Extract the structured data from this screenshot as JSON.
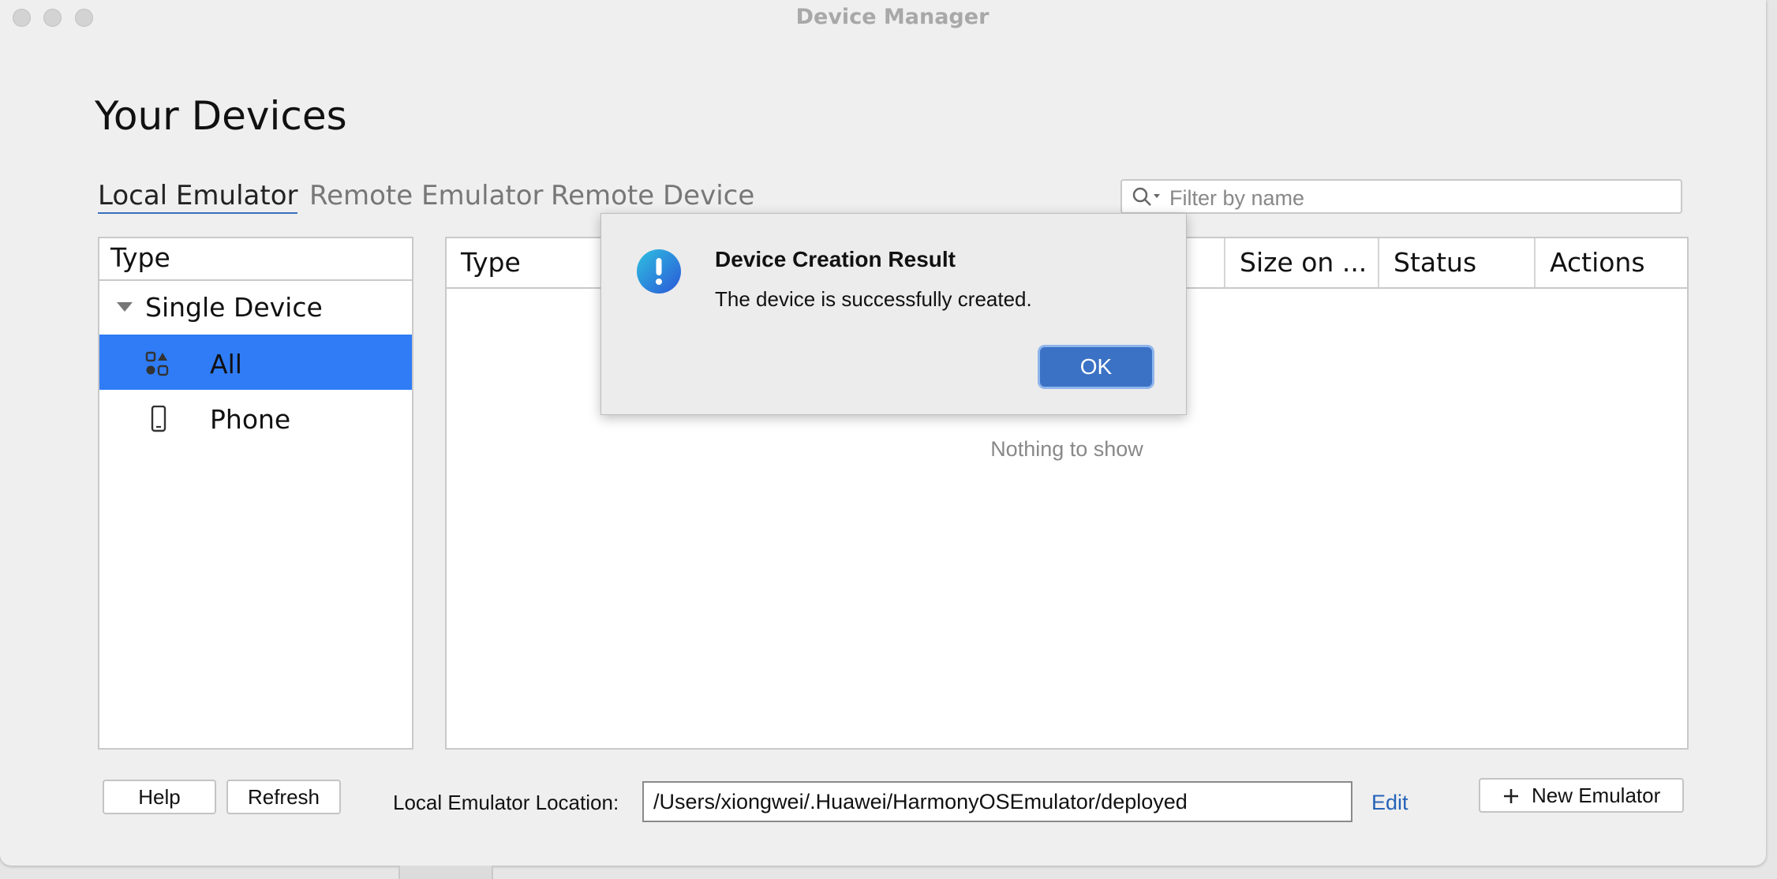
{
  "window": {
    "title": "Device Manager"
  },
  "page": {
    "title": "Your Devices"
  },
  "tabs": [
    {
      "label": "Local Emulator",
      "active": true
    },
    {
      "label": "Remote Emulator",
      "active": false
    },
    {
      "label": "Remote Device",
      "active": false
    }
  ],
  "search": {
    "placeholder": "Filter by name",
    "value": "",
    "icon": "search-filter-icon"
  },
  "left_panel": {
    "header": "Type",
    "group": "Single Device",
    "items": [
      {
        "label": "All",
        "icon": "grid-shapes-icon",
        "selected": true
      },
      {
        "label": "Phone",
        "icon": "phone-icon",
        "selected": false
      }
    ]
  },
  "table": {
    "columns": [
      "Type",
      "Size on ...",
      "Status",
      "Actions"
    ],
    "empty_text": "Nothing to show"
  },
  "dialog": {
    "title": "Device Creation Result",
    "message": "The device is successfully created.",
    "ok_label": "OK",
    "icon": "exclamation-icon"
  },
  "footer": {
    "help_label": "Help",
    "refresh_label": "Refresh",
    "location_label": "Local Emulator Location:",
    "location_value": "/Users/xiongwei/.Huawei/HarmonyOSEmulator/deployed",
    "edit_label": "Edit",
    "new_emulator_label": "New Emulator"
  },
  "colors": {
    "accent": "#2f7cf6",
    "ok_button": "#3b72c5",
    "link": "#2563b7"
  }
}
